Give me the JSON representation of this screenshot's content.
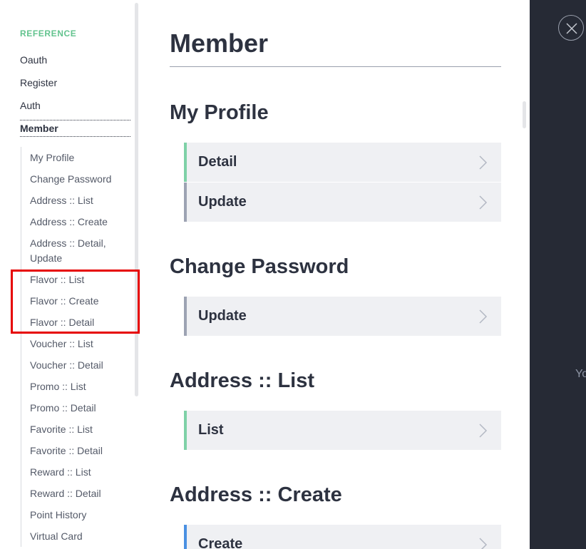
{
  "sidebar": {
    "heading": "REFERENCE",
    "top_items": [
      {
        "label": "Oauth"
      },
      {
        "label": "Register"
      },
      {
        "label": "Auth"
      },
      {
        "label": "Member"
      }
    ],
    "active_item": "Member",
    "sub_items": [
      {
        "label": "My Profile"
      },
      {
        "label": "Change Password"
      },
      {
        "label": "Address :: List"
      },
      {
        "label": "Address :: Create"
      },
      {
        "label": "Address :: Detail, Update"
      },
      {
        "label": "Flavor :: List"
      },
      {
        "label": "Flavor :: Create"
      },
      {
        "label": "Flavor :: Detail"
      },
      {
        "label": "Voucher :: List"
      },
      {
        "label": "Voucher :: Detail"
      },
      {
        "label": "Promo :: List"
      },
      {
        "label": "Promo :: Detail"
      },
      {
        "label": "Favorite :: List"
      },
      {
        "label": "Favorite :: Detail"
      },
      {
        "label": "Reward :: List"
      },
      {
        "label": "Reward :: Detail"
      },
      {
        "label": "Point History"
      },
      {
        "label": "Virtual Card"
      }
    ]
  },
  "main": {
    "title": "Member",
    "sections": [
      {
        "title": "My Profile",
        "endpoints": [
          {
            "label": "Detail",
            "method_color": "green"
          },
          {
            "label": "Update",
            "method_color": "gray"
          }
        ]
      },
      {
        "title": "Change Password",
        "endpoints": [
          {
            "label": "Update",
            "method_color": "gray"
          }
        ]
      },
      {
        "title": "Address :: List",
        "endpoints": [
          {
            "label": "List",
            "method_color": "green"
          }
        ]
      },
      {
        "title": "Address :: Create",
        "endpoints": [
          {
            "label": "Create",
            "method_color": "blue"
          }
        ]
      }
    ]
  },
  "right_panel": {
    "text": "Yo"
  },
  "colors": {
    "accent_green": "#62c38e",
    "get_border": "#7fd1a7",
    "put_border": "#9da3b3",
    "post_border": "#4a90e2",
    "highlight": "#e60000",
    "panel_bg": "#262a35"
  }
}
